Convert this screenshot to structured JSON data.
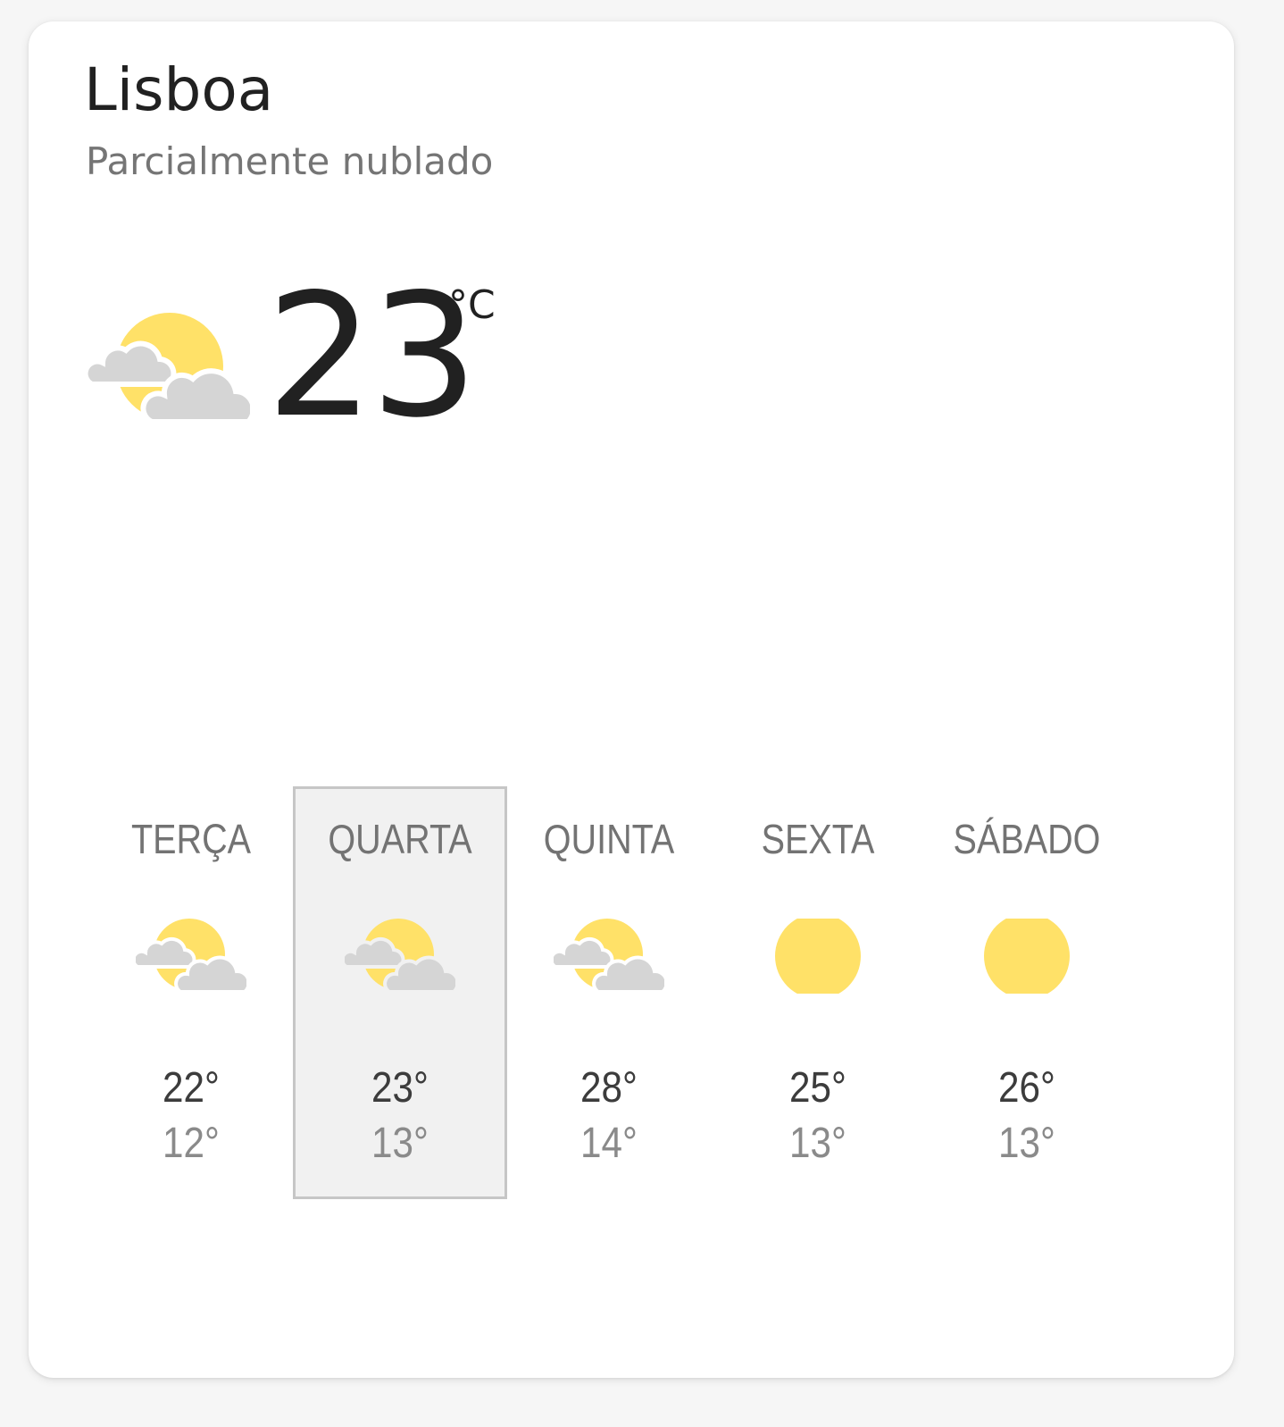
{
  "location": {
    "city": "Lisboa",
    "condition": "Parcialmente nublado"
  },
  "current": {
    "temperature": "23",
    "unit": "°C",
    "icon": "partly-cloudy-icon"
  },
  "forecast": [
    {
      "day": "TERÇA",
      "high": "22°",
      "low": "12°",
      "icon": "partly-cloudy-icon",
      "selected": false
    },
    {
      "day": "QUARTA",
      "high": "23°",
      "low": "13°",
      "icon": "partly-cloudy-icon",
      "selected": true
    },
    {
      "day": "QUINTA",
      "high": "28°",
      "low": "14°",
      "icon": "partly-cloudy-icon",
      "selected": false
    },
    {
      "day": "SEXTA",
      "high": "25°",
      "low": "13°",
      "icon": "sunny-icon",
      "selected": false
    },
    {
      "day": "SÁBADO",
      "high": "26°",
      "low": "13°",
      "icon": "sunny-icon",
      "selected": false
    }
  ],
  "colors": {
    "sun": "#FFE168",
    "cloud": "#D5D5D5",
    "selected_bg": "#F1F1F1",
    "selected_border": "#C6C6C6"
  }
}
